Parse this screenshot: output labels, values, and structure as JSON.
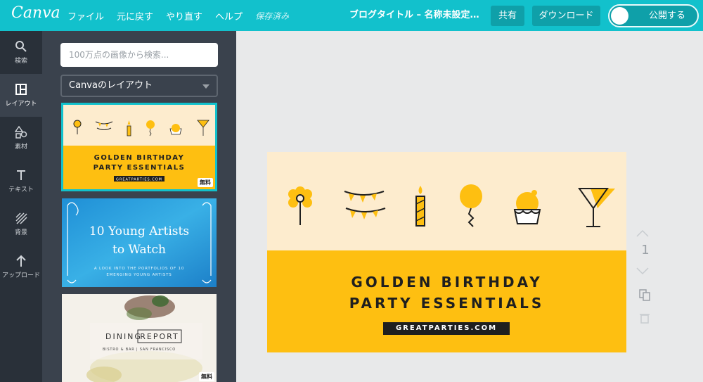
{
  "app": {
    "logo": "Canva"
  },
  "menu": {
    "file": "ファイル",
    "undo": "元に戻す",
    "redo": "やり直す",
    "help": "ヘルプ",
    "saved": "保存済み"
  },
  "header": {
    "doc_title": "ブログタイトル – 名称未設定のデザイン",
    "share": "共有",
    "download": "ダウンロード",
    "publish": "公開する"
  },
  "nav": [
    {
      "label": "検索",
      "icon": "search-icon"
    },
    {
      "label": "レイアウト",
      "icon": "layout-icon"
    },
    {
      "label": "素材",
      "icon": "shapes-icon"
    },
    {
      "label": "テキスト",
      "icon": "text-icon"
    },
    {
      "label": "背景",
      "icon": "background-icon"
    },
    {
      "label": "アップロード",
      "icon": "upload-arrow-icon"
    }
  ],
  "panel": {
    "search_placeholder": "100万点の画像から検索...",
    "layout_select": "Canvaのレイアウト",
    "thumbs": [
      {
        "line1": "GOLDEN BIRTHDAY",
        "line2": "PARTY ESSENTIALS",
        "url": "GREATPARTIES.COM",
        "badge": "無料"
      },
      {
        "line1": "10 Young Artists",
        "line2": "to Watch",
        "sub1": "A LOOK INTO THE PORTFOLIOS OF 10",
        "sub2": "EMERGING YOUNG ARTISTS"
      },
      {
        "title_a": "DINING",
        "title_b": "REPORT",
        "sub": "BISTRO & BAR | SAN FRANCISCO",
        "badge": "無料"
      }
    ]
  },
  "canvas": {
    "line1": "GOLDEN BIRTHDAY",
    "line2": "PARTY ESSENTIALS",
    "url": "GREATPARTIES.COM",
    "page_number": "1"
  },
  "colors": {
    "topbar": "#12c1cc",
    "nav": "#293039",
    "panel": "#3a424d",
    "accent_yellow": "#febf11",
    "cream": "#fdecce"
  }
}
